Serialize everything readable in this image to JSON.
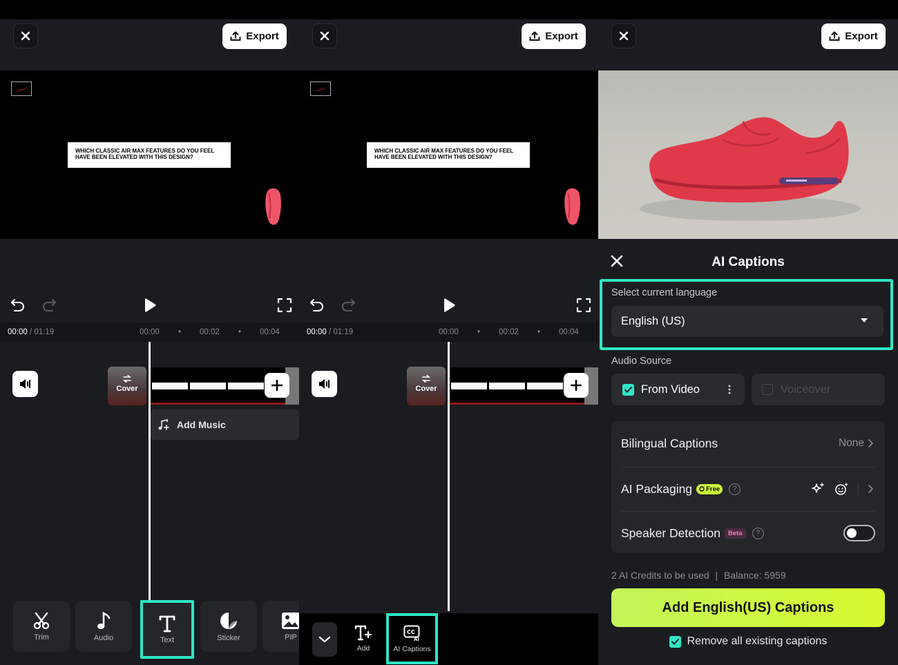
{
  "colors": {
    "accent": "#2ee6c4",
    "cta": "#d2f93a",
    "background": "#1b1c1f"
  },
  "panel1": {
    "export_label": "Export",
    "caption_text": "WHICH CLASSIC AIR MAX FEATURES DO YOU FEEL HAVE BEEN ELEVATED WITH THIS DESIGN?",
    "time_current": "00:00",
    "time_total": "/ 01:19",
    "ticks": [
      "00:00",
      "00:02",
      "00:04"
    ],
    "cover_label": "Cover",
    "add_music_label": "Add Music",
    "tools": [
      {
        "label": "Trim",
        "icon": "scissors-icon"
      },
      {
        "label": "Audio",
        "icon": "music-note-icon"
      },
      {
        "label": "Text",
        "icon": "text-icon"
      },
      {
        "label": "Sticker",
        "icon": "sticker-icon"
      },
      {
        "label": "PIP",
        "icon": "image-icon"
      }
    ]
  },
  "panel2": {
    "export_label": "Export",
    "caption_text": "WHICH CLASSIC AIR MAX FEATURES DO YOU FEEL HAVE BEEN ELEVATED WITH THIS DESIGN?",
    "time_current": "00:00",
    "time_total": "/ 01:19",
    "ticks": [
      "00:00",
      "00:02",
      "00:04"
    ],
    "cover_label": "Cover",
    "tools": [
      {
        "label": "Add",
        "icon": "add-text-icon"
      },
      {
        "label": "AI Captions",
        "icon": "ai-captions-icon"
      }
    ]
  },
  "panel3": {
    "export_label": "Export",
    "title": "AI Captions",
    "select_language_label": "Select current language",
    "language_value": "English (US)",
    "audio_source_label": "Audio Source",
    "source_from_video": "From Video",
    "source_voiceover": "Voiceover",
    "bilingual_label": "Bilingual Captions",
    "bilingual_value": "None",
    "packaging_label": "AI Packaging",
    "packaging_badge": "Free",
    "speaker_label": "Speaker Detection",
    "speaker_badge": "Beta",
    "speaker_enabled": false,
    "credits_text": "2 AI Credits to be used",
    "balance_text": "Balance: 5959",
    "cta_label": "Add English(US) Captions",
    "remove_label": "Remove all existing captions",
    "remove_checked": true
  }
}
